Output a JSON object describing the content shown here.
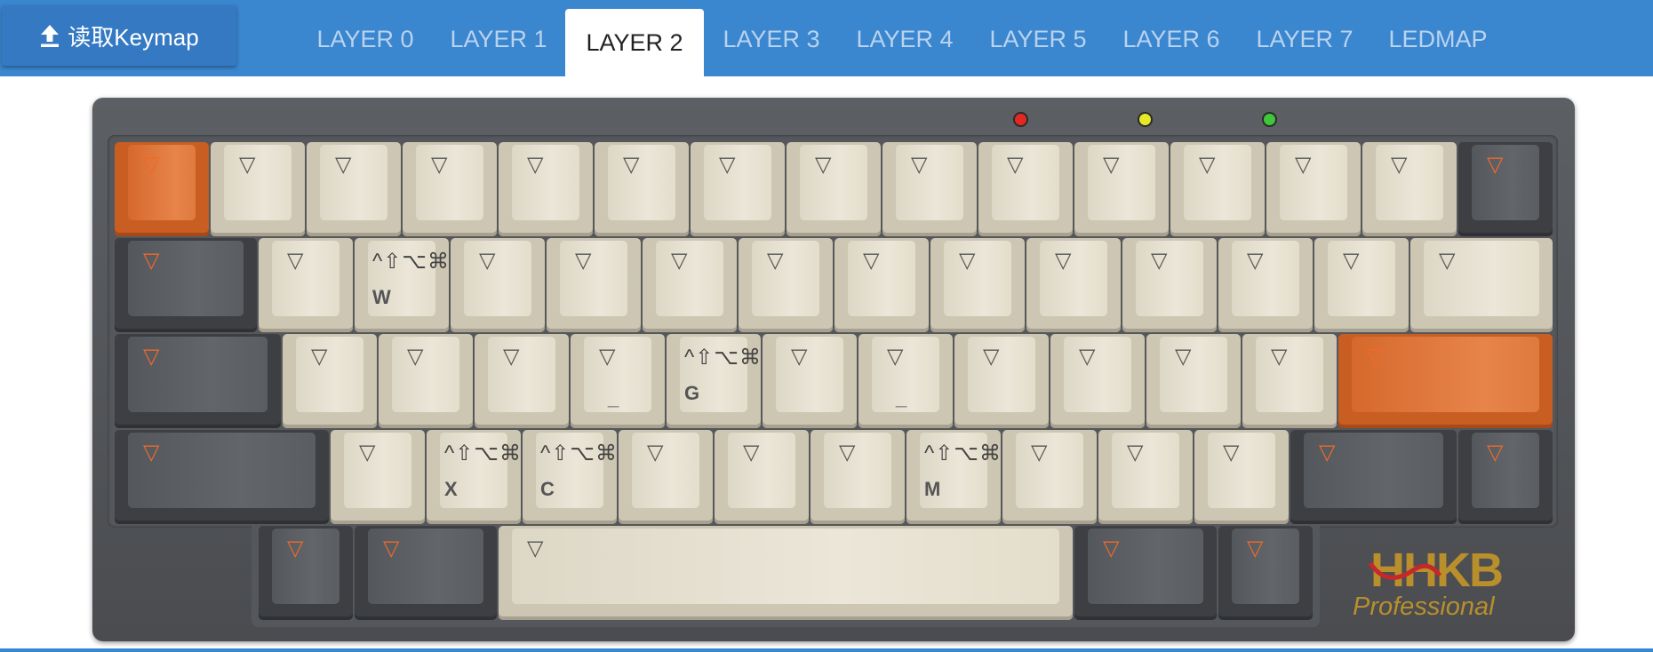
{
  "toolbar": {
    "read_keymap_label": "读取Keymap",
    "read_icon": "upload-icon"
  },
  "tabs": [
    "LAYER 0",
    "LAYER 1",
    "LAYER 2",
    "LAYER 3",
    "LAYER 4",
    "LAYER 5",
    "LAYER 6",
    "LAYER 7",
    "LEDMAP"
  ],
  "active_tab": "LAYER 2",
  "leds": [
    {
      "name": "red",
      "color": "#e32822"
    },
    {
      "name": "yellow",
      "color": "#e8e82a"
    },
    {
      "name": "green",
      "color": "#3fc63a"
    }
  ],
  "keyboard": {
    "transparent_glyph": "▽",
    "mod_glyph": "^⇧⌥⌘",
    "underscore_glyph": "_",
    "keys_labeled": {
      "W": "W",
      "G": "G",
      "X": "X",
      "C": "C",
      "M": "M"
    }
  },
  "logo": {
    "brand": "HHKB",
    "sub": "Professional"
  },
  "colors": {
    "accent": "#3a86cf",
    "key_light": "#e4dece",
    "key_dark": "#5a5d61",
    "key_orange": "#e07a3e"
  }
}
